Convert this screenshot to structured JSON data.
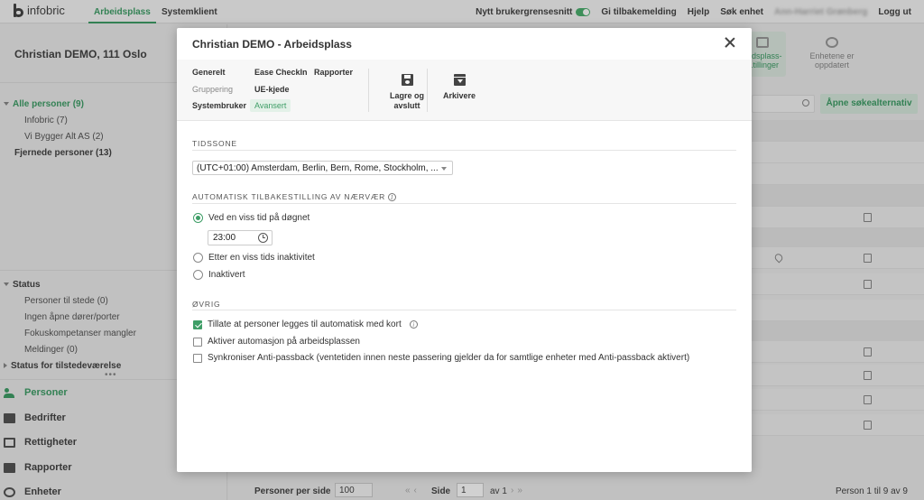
{
  "topbar": {
    "logo_text": "infobric",
    "tabs": [
      {
        "label": "Arbeidsplass",
        "active": true
      },
      {
        "label": "Systemklient",
        "active": false
      }
    ],
    "new_ui_label": "Nytt brukergrensesnitt",
    "new_ui_enabled": true,
    "feedback": "Gi tilbakemelding",
    "help": "Hjelp",
    "search_unit": "Søk enhet",
    "user_name": "Ann-Harriet Grønberg",
    "logout": "Logg ut"
  },
  "sidebar": {
    "workplace_title": "Christian DEMO, 111 Oslo",
    "all_persons": "Alle personer (9)",
    "groups": [
      "Infobric (7)",
      "Vi Bygger Alt AS (2)"
    ],
    "removed_persons": "Fjernede personer (13)",
    "status_header": "Status",
    "status_items": [
      "Personer til stede (0)",
      "Ingen åpne dører/porter",
      "Fokuskompetanser mangler",
      "Meldinger (0)"
    ],
    "presence_status": "Status for tilstedeværelse",
    "nav": [
      {
        "label": "Personer",
        "icon": "people-icon",
        "active": true
      },
      {
        "label": "Bedrifter",
        "icon": "briefcase-icon",
        "active": false
      },
      {
        "label": "Rettigheter",
        "icon": "calendar-check-icon",
        "active": false
      },
      {
        "label": "Rapporter",
        "icon": "report-icon",
        "active": false
      },
      {
        "label": "Enheter",
        "icon": "device-icon",
        "active": false
      }
    ]
  },
  "background": {
    "header_buttons": [
      "...idsplass-\n...tillinger",
      "Enhetene er\noppdatert"
    ],
    "open_search_button": "Åpne søkealternativ",
    "pager": {
      "per_page_label": "Personer per side",
      "per_page_value": "100",
      "page_label": "Side",
      "page_value": "1",
      "of_label": "av 1",
      "count_text": "Person 1 til 9 av 9"
    }
  },
  "modal": {
    "title": "Christian DEMO - Arbeidsplass",
    "close_icon": "close-icon",
    "nav_links": {
      "generelt": "Generelt",
      "ease_checkin": "Ease CheckIn",
      "rapporter": "Rapporter",
      "gruppering": "Gruppering",
      "ue_kjede": "UE-kjede",
      "systembruker": "Systembruker",
      "avansert": "Avansert"
    },
    "active_link": "Avansert",
    "save_button": "Lagre og\navslutt",
    "archive_button": "Arkivere",
    "timezone": {
      "heading": "TIDSSONE",
      "value": "(UTC+01:00) Amsterdam, Berlin, Bern, Rome, Stockholm, ..."
    },
    "auto_reset": {
      "heading": "AUTOMATISK TILBAKESTILLING AV NÆRVÆR",
      "options": [
        {
          "label": "Ved en viss tid på døgnet",
          "selected": true
        },
        {
          "label": "Etter en viss tids inaktivitet",
          "selected": false
        },
        {
          "label": "Inaktivert",
          "selected": false
        }
      ],
      "time_value": "23:00"
    },
    "other": {
      "heading": "ØVRIG",
      "checkboxes": [
        {
          "label": "Tillate at personer legges til automatisk med kort",
          "checked": true,
          "has_info": true
        },
        {
          "label": "Aktiver automasjon på arbeidsplassen",
          "checked": false,
          "has_info": false
        },
        {
          "label": "Synkroniser Anti-passback (ventetiden innen neste passering gjelder da for samtlige enheter med Anti-passback aktivert)",
          "checked": false,
          "has_info": false
        }
      ]
    }
  },
  "colors": {
    "accent": "#3f9e67",
    "overlay": "rgba(0,0,0,0.18)"
  }
}
